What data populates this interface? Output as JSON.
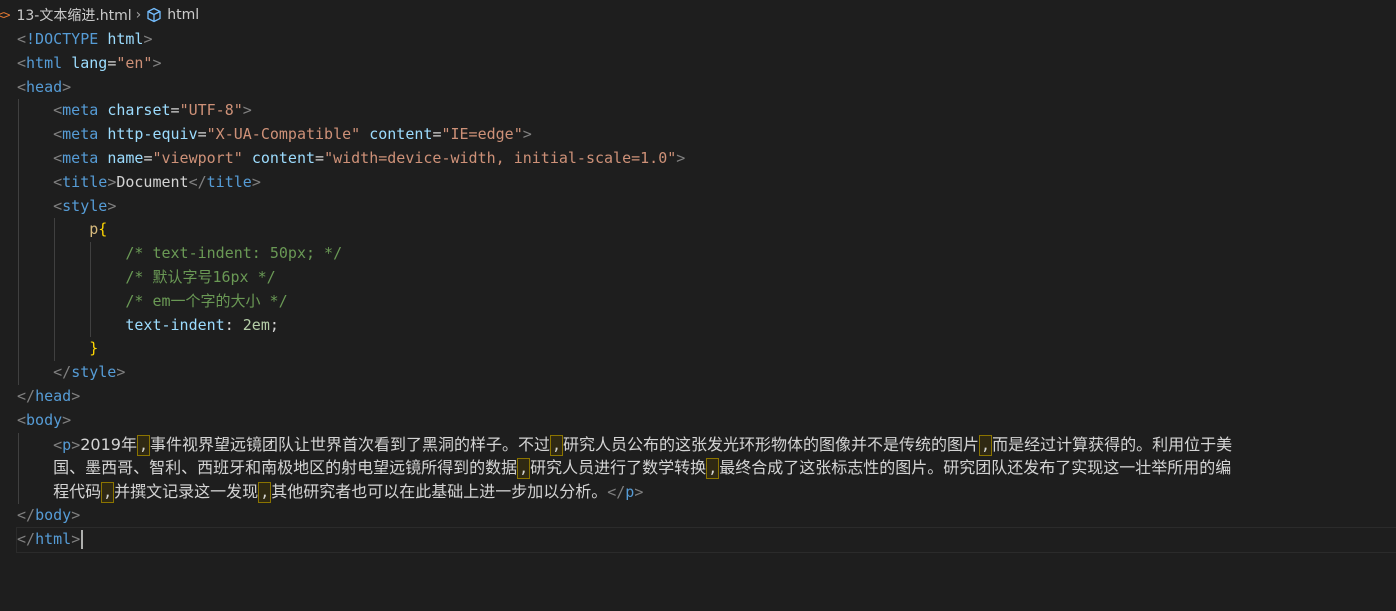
{
  "breadcrumb": {
    "file_icon": "<>",
    "file_name": "13-文本缩进.html",
    "separator": "›",
    "symbol_icon": "cube-icon",
    "symbol": "html"
  },
  "code": {
    "doctype": "<!DOCTYPE html>",
    "html_open": {
      "tag": "html",
      "attr": "lang",
      "value": "\"en\""
    },
    "head_tag": "head",
    "meta1": {
      "attr": "charset",
      "value": "\"UTF-8\""
    },
    "meta2": {
      "attr1": "http-equiv",
      "value1": "\"X-UA-Compatible\"",
      "attr2": "content",
      "value2": "\"IE=edge\""
    },
    "meta3": {
      "attr1": "name",
      "value1": "\"viewport\"",
      "attr2": "content",
      "value2": "\"width=device-width, initial-scale=1.0\""
    },
    "meta_tag": "meta",
    "title_tag": "title",
    "title_text": "Document",
    "style_tag": "style",
    "css_selector": "p",
    "comment1": "/* text-indent: 50px; */",
    "comment2": "/* 默认字号16px */",
    "comment3": "/* em一个字的大小 */",
    "css_prop": "text-indent",
    "css_value": "2em",
    "body_tag": "body",
    "p_tag": "p",
    "para": {
      "l1_a": "2019年",
      "l1_b": "事件视界望远镜团队让世界首次看到了黑洞的样子。不过",
      "l1_c": "研究人员公布的这张发光环形物体的图像并不是传统的图片",
      "l1_d": "而是经过计算获得的。利用位于美",
      "l2_a": "国、墨西哥、智利、西班牙和南极地区的射电望远镜所得到的数据",
      "l2_b": "研究人员进行了数学转换",
      "l2_c": "最终合成了这张标志性的图片。研究团队还发布了实现这一壮举所用的编",
      "l3_a": "程代码",
      "l3_b": "并撰文记录这一发现",
      "l3_c": "其他研究者也可以在此基础上进一步加以分析。",
      "comma": ","
    }
  }
}
